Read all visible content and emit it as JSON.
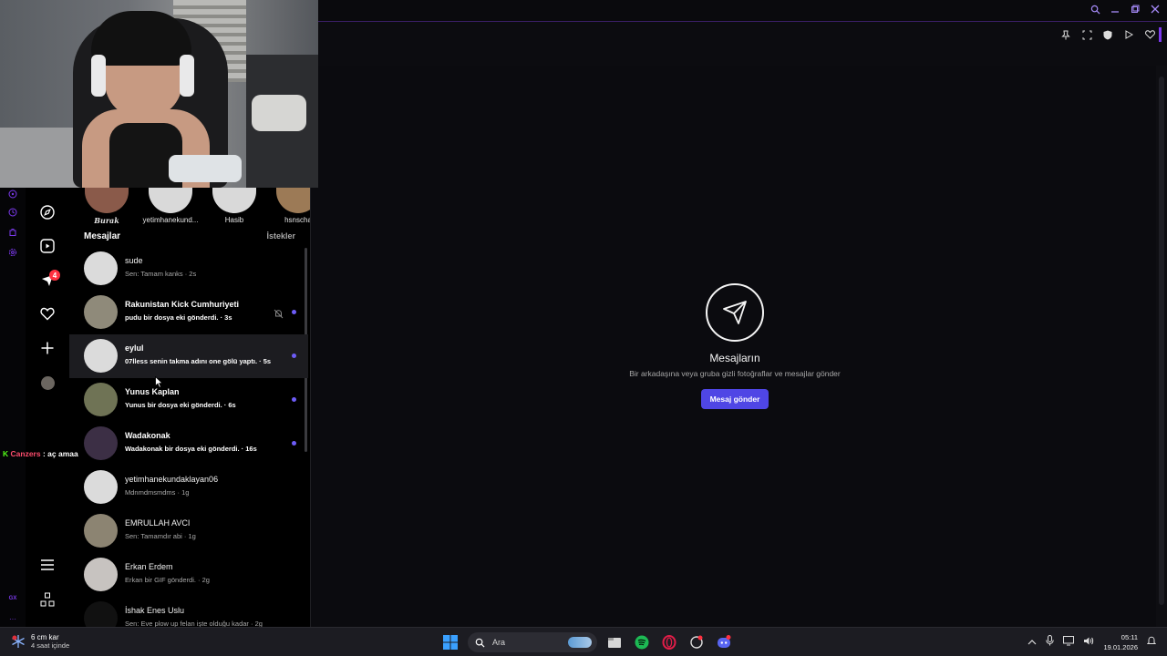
{
  "stories": [
    {
      "name": "Burak"
    },
    {
      "name": "yetimhanekund..."
    },
    {
      "name": "Hasib"
    },
    {
      "name": "hsnscha"
    }
  ],
  "messages_panel": {
    "heading": "Mesajlar",
    "requests_label": "İstekler",
    "conversations": [
      {
        "name": "sude",
        "preview": "Sen: Tamam kanks · 2s",
        "unread": false,
        "muted": false
      },
      {
        "name": "Rakunistan Kick Cumhuriyeti",
        "preview": "pudu bir dosya eki gönderdi. · 3s",
        "unread": true,
        "muted": true
      },
      {
        "name": "eylul",
        "preview": "07lless senin takma adını one gölü yaptı. · 5s",
        "unread": true,
        "muted": false
      },
      {
        "name": "Yunus Kaplan",
        "preview": "Yunus bir dosya eki gönderdi. · 6s",
        "unread": true,
        "muted": false
      },
      {
        "name": "Wadakonak",
        "preview": "Wadakonak bir dosya eki gönderdi. · 16s",
        "unread": true,
        "muted": false
      },
      {
        "name": "yetimhanekundaklayan06",
        "preview": "Mdnmdmsmdms · 1g",
        "unread": false,
        "muted": false
      },
      {
        "name": "EMRULLAH AVCI",
        "preview": "Sen: Tamamdır abi · 1g",
        "unread": false,
        "muted": false
      },
      {
        "name": "Erkan Erdem",
        "preview": "Erkan bir GIF gönderdi. · 2g",
        "unread": false,
        "muted": false
      },
      {
        "name": "İshak Enes Uslu",
        "preview": "Sen: Eve plow up felan işte olduğu kadar · 2g",
        "unread": false,
        "muted": false
      }
    ]
  },
  "nav": {
    "notification_count": "4"
  },
  "chat_overlay": {
    "platform_mark": "K",
    "user": "Canzers",
    "message": ": aç amaa"
  },
  "empty_state": {
    "title": "Mesajların",
    "subtitle": "Bir arkadaşına veya gruba gizli fotoğraflar ve mesajlar gönder",
    "button_label": "Mesaj gönder"
  },
  "rail": {
    "label": "GX"
  },
  "taskbar": {
    "weather_temp": "6 cm kar",
    "weather_sub": "4 saat içinde",
    "search_placeholder": "Ara",
    "time": "05:11",
    "date": "19.01.2026"
  },
  "colors": {
    "accent": "#4f46e5",
    "unread_dot": "#6d5cf7",
    "badge": "#ff3040",
    "opera_gx": "#7c3aed"
  }
}
